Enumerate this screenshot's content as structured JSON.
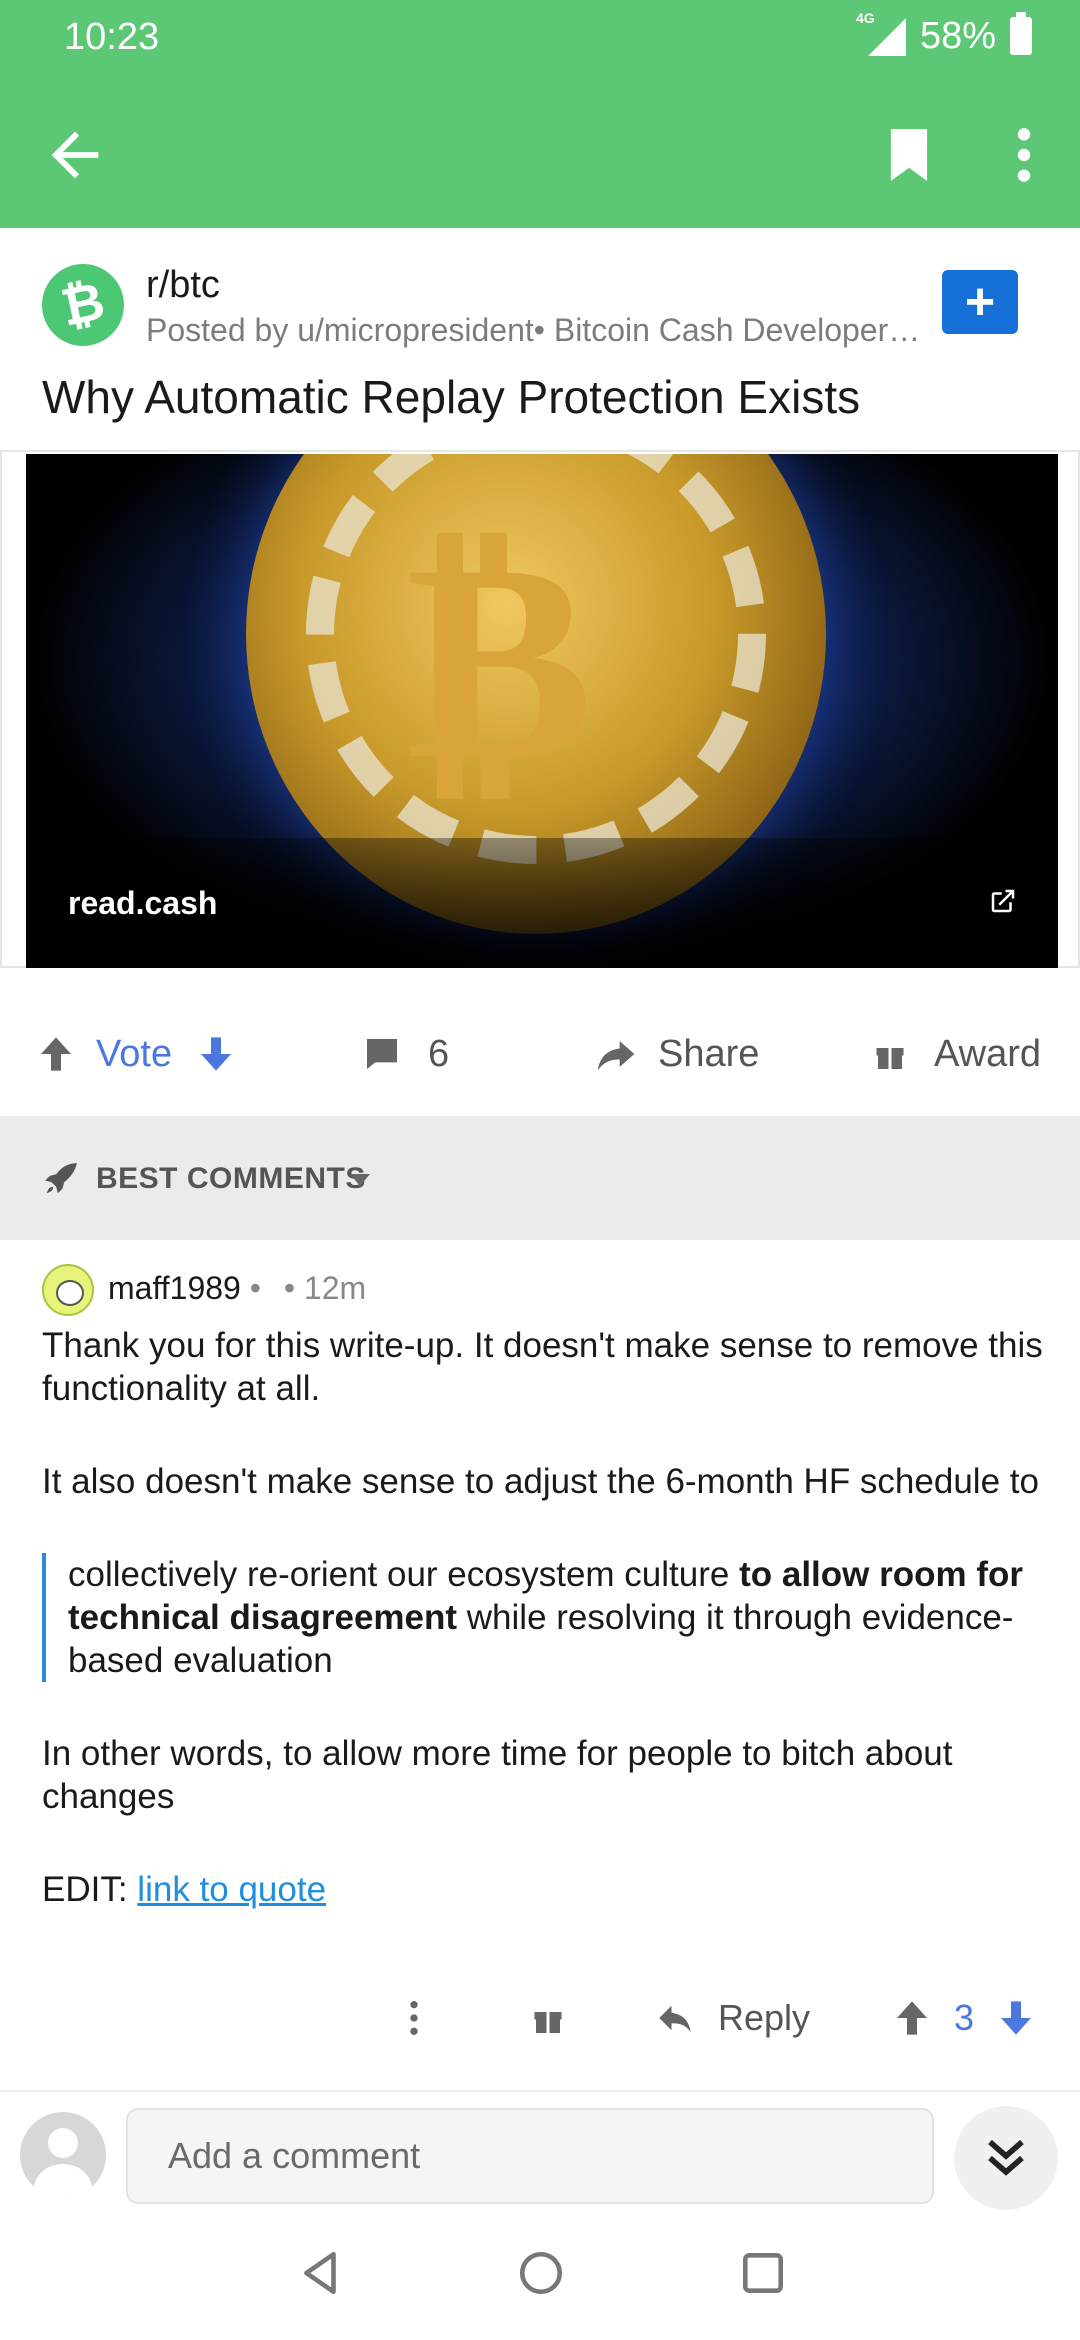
{
  "status_bar": {
    "time": "10:23",
    "network": "4G",
    "battery": "58%"
  },
  "app_bar": {
    "back_icon": "arrow-left-icon",
    "bookmark_icon": "bookmark-icon",
    "more_icon": "more-vertical-icon"
  },
  "post": {
    "subreddit": "r/btc",
    "subreddit_icon": "bitcoin-icon",
    "posted_by": "Posted by u/micropresident• Bitcoin Cash Developer …",
    "join_label": "+",
    "title": "Why Automatic Replay Protection Exists",
    "link_domain": "read.cash",
    "actions": {
      "vote_label": "Vote",
      "comment_count": "6",
      "share_label": "Share",
      "award_label": "Award"
    }
  },
  "sort": {
    "label": "BEST COMMENTS"
  },
  "comment": {
    "author": "maff1989",
    "separator": " •",
    "age": " • 12m",
    "p1": "Thank you for this write-up. It doesn't make sense to remove this functionality at all.",
    "p2": "It also doesn't make sense to adjust the 6-month HF schedule to",
    "quote_a": "collectively re-orient our ecosystem culture ",
    "quote_bold": "to allow room for technical disagreement",
    "quote_b": " while resolving it through evidence-based evaluation",
    "p3": "In other words, to allow more time for people to bitch about changes",
    "edit_prefix": "EDIT: ",
    "edit_link": "link to quote",
    "reply_label": "Reply",
    "score": "3"
  },
  "composer": {
    "placeholder": "Add a comment"
  },
  "colors": {
    "header_green": "#5cc876",
    "vote_blue": "#4a78e0",
    "join_blue": "#1670d8",
    "link_blue": "#1f8ee0"
  }
}
